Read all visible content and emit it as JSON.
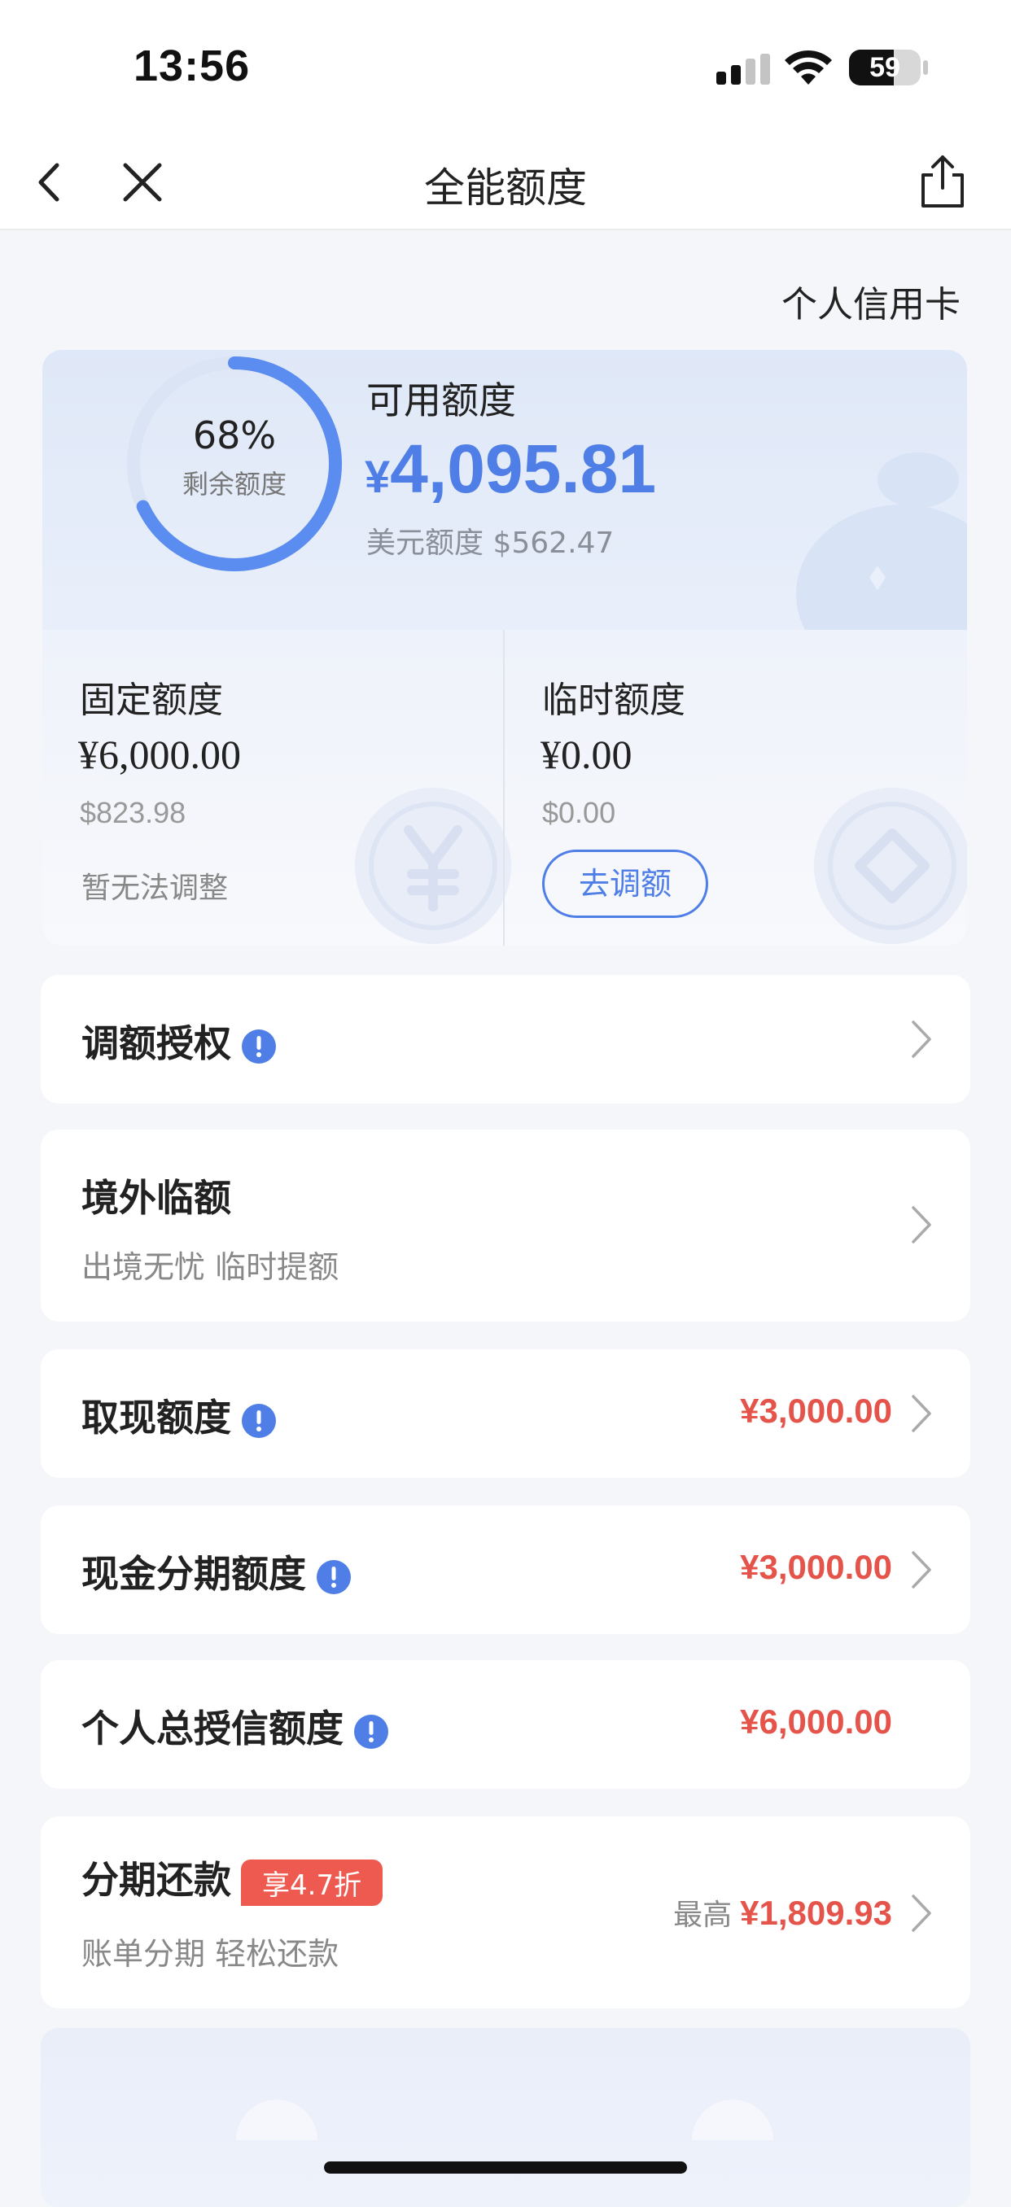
{
  "status_bar": {
    "time": "13:56",
    "battery_level": "59"
  },
  "nav": {
    "title": "全能额度"
  },
  "card_type": "个人信用卡",
  "credit": {
    "remaining_pct_value": 0.68,
    "remaining_pct": "68%",
    "remaining_label": "剩余额度",
    "available_title": "可用额度",
    "available_currency": "¥",
    "available_amount": "4,095.81",
    "usd_label": "美元额度",
    "usd_amount": "$562.47",
    "fixed": {
      "title": "固定额度",
      "amount": "¥6,000.00",
      "usd": "$823.98",
      "note": "暂无法调整"
    },
    "temp": {
      "title": "临时额度",
      "amount": "¥0.00",
      "usd": "$0.00",
      "button": "去调额"
    }
  },
  "list": {
    "auth": {
      "title": "调额授权"
    },
    "overseas": {
      "title": "境外临额",
      "subtitle": "出境无忧 临时提额"
    },
    "cash": {
      "title": "取现额度",
      "value": "¥3,000.00"
    },
    "cash_installment": {
      "title": "现金分期额度",
      "value": "¥3,000.00"
    },
    "total_credit": {
      "title": "个人总授信额度",
      "value": "¥6,000.00"
    },
    "installment": {
      "title": "分期还款",
      "badge": "享4.7折",
      "subtitle": "账单分期 轻松还款",
      "prefix": "最高",
      "value": "¥1,809.93"
    }
  },
  "colors": {
    "accent": "#4f7fe6",
    "amount_red": "#e5544b",
    "badge_red": "#ee5a4f"
  },
  "icons": [
    "back-icon",
    "close-icon",
    "share-icon",
    "info-icon",
    "chevron-right-icon",
    "signal-icon",
    "wifi-icon",
    "battery-icon"
  ]
}
